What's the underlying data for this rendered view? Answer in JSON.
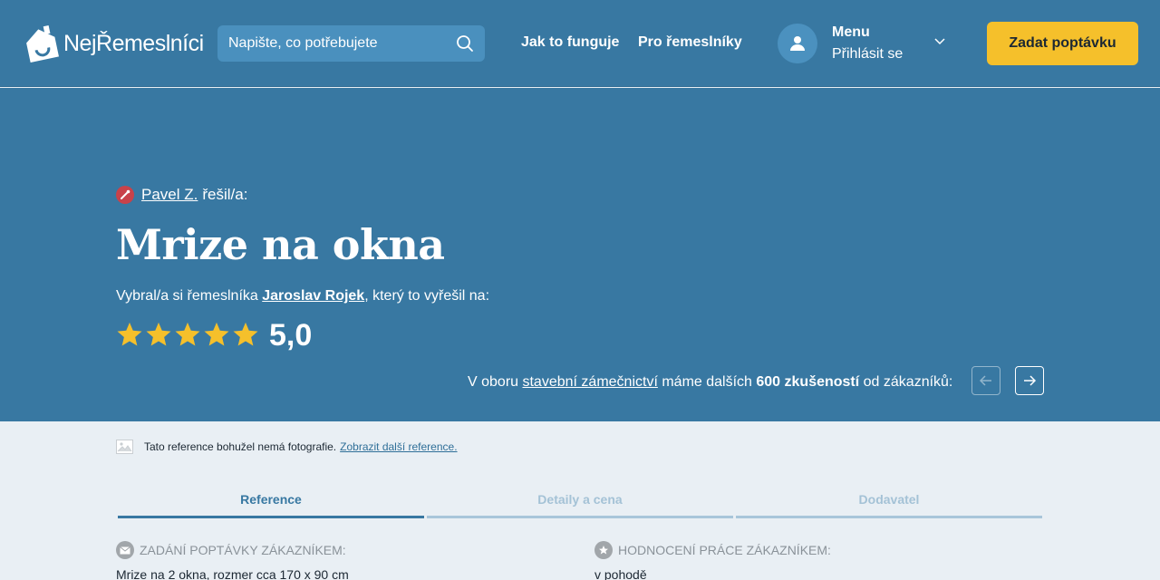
{
  "header": {
    "logo_text": "NejŘemeslníci",
    "search_placeholder": "Napište, co potřebujete",
    "nav_how": "Jak to funguje",
    "nav_pro": "Pro řemeslníky",
    "menu_title": "Menu",
    "menu_login": "Přihlásit se",
    "cta_label": "Zadat poptávku"
  },
  "hero": {
    "author_name": "Pavel Z.",
    "author_suffix": "řešil/a:",
    "title": "Mrize na okna",
    "chosen_prefix": "Vybral/a si řemeslníka ",
    "craftsman_name": "Jaroslav Rojek",
    "chosen_suffix": ", který to vyřešil na:",
    "rating": 5,
    "rating_value": "5,0",
    "field_prefix": "V oboru ",
    "field_link": "stavební zámečnictví",
    "field_middle": " máme dalších ",
    "field_count": "600 zkušeností",
    "field_suffix": " od zákazníků:"
  },
  "content": {
    "nophoto_text": "Tato reference bohužel nemá fotografie.",
    "nophoto_link": "Zobrazit další reference.",
    "tabs": [
      {
        "label": "Reference"
      },
      {
        "label": "Detaily a cena"
      },
      {
        "label": "Dodavatel"
      }
    ],
    "left_heading": "ZADÁNÍ POPTÁVKY ZÁKAZNÍKEM:",
    "left_text": "Mrize na 2 okna, rozmer cca 170 x 90 cm",
    "right_heading": "HODNOCENÍ PRÁCE ZÁKAZNÍKEM:",
    "right_text": "v pohodě"
  },
  "colors": {
    "header_bg": "#3878a2",
    "cta_bg": "#f5c02b",
    "star": "#f5c02b",
    "content_bg": "#e9eff4"
  }
}
